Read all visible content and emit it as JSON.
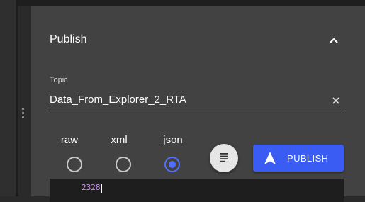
{
  "panel": {
    "title": "Publish",
    "topic": {
      "label": "Topic",
      "value": "Data_From_Explorer_2_RTA"
    },
    "formats": [
      {
        "label": "raw",
        "selected": false
      },
      {
        "label": "xml",
        "selected": false
      },
      {
        "label": "json",
        "selected": true
      }
    ],
    "publish_label": "PUBLISH",
    "editor_text": "2328"
  },
  "colors": {
    "accent": "#536dfe",
    "button": "#3a5cf2",
    "panel": "#424242",
    "editor_bg": "#1e1e1e"
  }
}
